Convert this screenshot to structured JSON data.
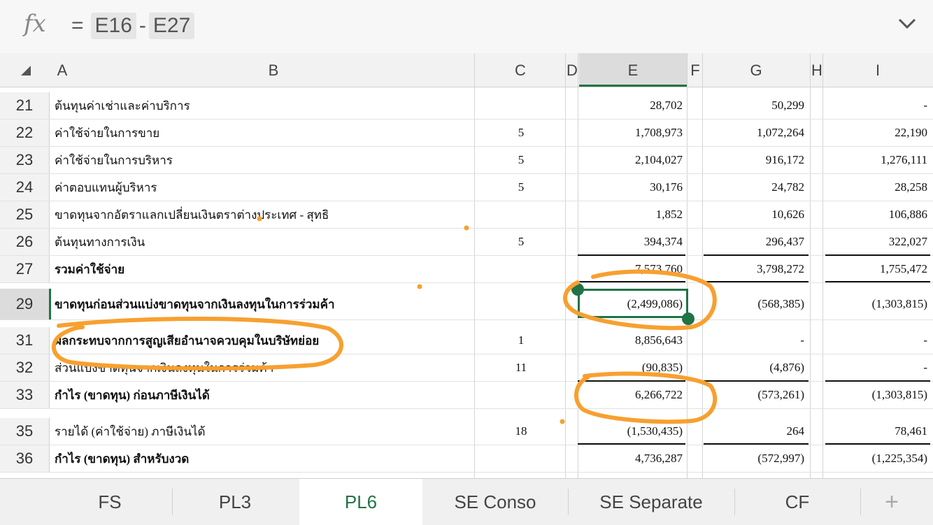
{
  "formula_bar": {
    "fx_label": "fx",
    "equals": "=",
    "ref1": "E16",
    "operator": "-",
    "ref2": "E27"
  },
  "columns": [
    "A",
    "B",
    "C",
    "D",
    "E",
    "F",
    "G",
    "H",
    "I"
  ],
  "rows": [
    {
      "num": "21",
      "b": "ต้นทุนค่าเช่าและค่าบริการ",
      "c": "",
      "e": "28,702",
      "g": "50,299",
      "i": "-"
    },
    {
      "num": "22",
      "b": "ค่าใช้จ่ายในการขาย",
      "c": "5",
      "e": "1,708,973",
      "g": "1,072,264",
      "i": "22,190"
    },
    {
      "num": "23",
      "b": "ค่าใช้จ่ายในการบริหาร",
      "c": "5",
      "e": "2,104,027",
      "g": "916,172",
      "i": "1,276,111"
    },
    {
      "num": "24",
      "b": "ค่าตอบแทนผู้บริหาร",
      "c": "5",
      "e": "30,176",
      "g": "24,782",
      "i": "28,258"
    },
    {
      "num": "25",
      "b": "ขาดทุนจากอัตราแลกเปลี่ยนเงินตราต่างประเทศ - สุทธิ",
      "c": "",
      "e": "1,852",
      "g": "10,626",
      "i": "106,886"
    },
    {
      "num": "26",
      "b": "ต้นทุนทางการเงิน",
      "c": "5",
      "e": "394,374",
      "g": "296,437",
      "i": "322,027"
    },
    {
      "num": "27",
      "b": "รวมค่าใช้จ่าย",
      "c": "",
      "e": "7,573,760",
      "g": "3,798,272",
      "i": "1,755,472"
    },
    {
      "num": "29",
      "b": "ขาดทุนก่อนส่วนแบ่งขาดทุนจากเงินลงทุนในการร่วมค้า",
      "c": "",
      "e": "(2,499,086)",
      "g": "(568,385)",
      "i": "(1,303,815)"
    },
    {
      "num": "31",
      "b": "ผลกระทบจากการสูญเสียอำนาจควบคุมในบริษัทย่อย",
      "c": "1",
      "e": "8,856,643",
      "g": "-",
      "i": "-"
    },
    {
      "num": "32",
      "b": "ส่วนแบ่งขาดทุนจากเงินลงทุนในการร่วมค้า",
      "c": "11",
      "e": "(90,835)",
      "g": "(4,876)",
      "i": "-"
    },
    {
      "num": "33",
      "b": "กำไร (ขาดทุน) ก่อนภาษีเงินได้",
      "c": "",
      "e": "6,266,722",
      "g": "(573,261)",
      "i": "(1,303,815)"
    },
    {
      "num": "35",
      "b": "รายได้ (ค่าใช้จ่าย) ภาษีเงินได้",
      "c": "18",
      "e": "(1,530,435)",
      "g": "264",
      "i": "78,461"
    },
    {
      "num": "36",
      "b": "กำไร (ขาดทุน) สำหรับงวด",
      "c": "",
      "e": "4,736,287",
      "g": "(572,997)",
      "i": "(1,225,354)"
    }
  ],
  "tabs": [
    "FS",
    "PL3",
    "PL6",
    "SE Conso",
    "SE Separate",
    "CF",
    "+"
  ],
  "active_tab": "PL6",
  "colors": {
    "accent": "#217346",
    "annotation": "#f7a030"
  }
}
